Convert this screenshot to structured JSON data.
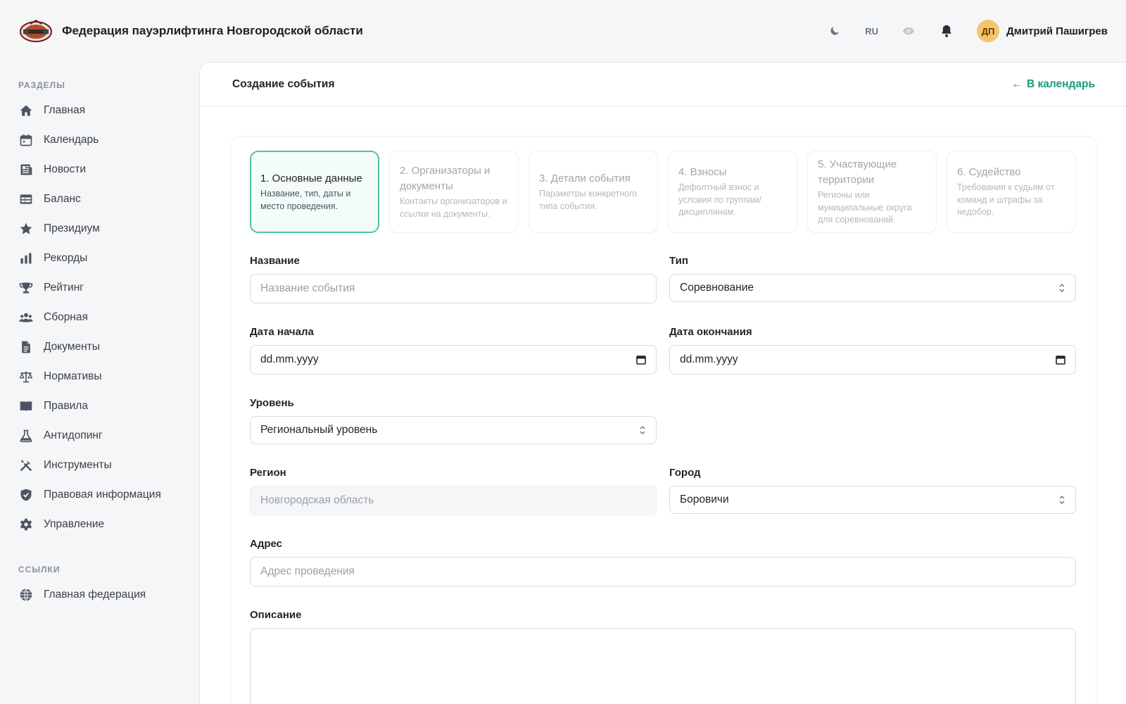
{
  "header": {
    "org_title": "Федерация пауэрлифтинга Новгородской области",
    "lang": "RU",
    "user": {
      "initials": "ДП",
      "name": "Дмитрий Пашигрев"
    }
  },
  "sidebar": {
    "section_main": "РАЗДЕЛЫ",
    "items": [
      {
        "label": "Главная",
        "icon": "home-icon"
      },
      {
        "label": "Календарь",
        "icon": "calendar-icon"
      },
      {
        "label": "Новости",
        "icon": "newspaper-icon"
      },
      {
        "label": "Баланс",
        "icon": "table-icon"
      },
      {
        "label": "Президиум",
        "icon": "star-icon"
      },
      {
        "label": "Рекорды",
        "icon": "bar-chart-icon"
      },
      {
        "label": "Рейтинг",
        "icon": "trophy-icon"
      },
      {
        "label": "Сборная",
        "icon": "users-icon"
      },
      {
        "label": "Документы",
        "icon": "document-icon"
      },
      {
        "label": "Нормативы",
        "icon": "scales-icon"
      },
      {
        "label": "Правила",
        "icon": "book-icon"
      },
      {
        "label": "Антидопинг",
        "icon": "flask-icon"
      },
      {
        "label": "Инструменты",
        "icon": "tools-icon"
      },
      {
        "label": "Правовая информация",
        "icon": "shield-icon"
      },
      {
        "label": "Управление",
        "icon": "gear-icon"
      }
    ],
    "section_links": "ССЫЛКИ",
    "links": [
      {
        "label": "Главная федерация",
        "icon": "globe-icon"
      }
    ]
  },
  "page": {
    "title": "Создание события",
    "back_link": "В календарь"
  },
  "steps": [
    {
      "title": "1. Основные данные",
      "desc": "Название, тип, даты и место проведения.",
      "active": true
    },
    {
      "title": "2. Организаторы и документы",
      "desc": "Контакты организаторов и ссылки на документы.",
      "active": false
    },
    {
      "title": "3. Детали события",
      "desc": "Параметры конкретного типа события.",
      "active": false
    },
    {
      "title": "4. Взносы",
      "desc": "Дефолтный взнос и условия по группам/дисциплинам.",
      "active": false
    },
    {
      "title": "5. Участвующие территории",
      "desc": "Регионы или муниципальные округа для соревнований.",
      "active": false
    },
    {
      "title": "6. Судейство",
      "desc": "Требования к судьям от команд и штрафы за недобор.",
      "active": false
    }
  ],
  "form": {
    "name": {
      "label": "Название",
      "placeholder": "Название события",
      "value": ""
    },
    "type": {
      "label": "Тип",
      "value": "Соревнование"
    },
    "start_date": {
      "label": "Дата начала",
      "value": "dd.mm.yyyy"
    },
    "end_date": {
      "label": "Дата окончания",
      "value": "dd.mm.yyyy"
    },
    "level": {
      "label": "Уровень",
      "value": "Региональный уровень"
    },
    "region": {
      "label": "Регион",
      "value": "Новгородская область"
    },
    "city": {
      "label": "Город",
      "value": "Боровичи"
    },
    "address": {
      "label": "Адрес",
      "placeholder": "Адрес проведения",
      "value": ""
    },
    "description": {
      "label": "Описание",
      "value": ""
    }
  },
  "colors": {
    "accent": "#1a9b7c",
    "active_step_border": "#4fc3a1",
    "avatar_bg": "#f4c56a"
  }
}
